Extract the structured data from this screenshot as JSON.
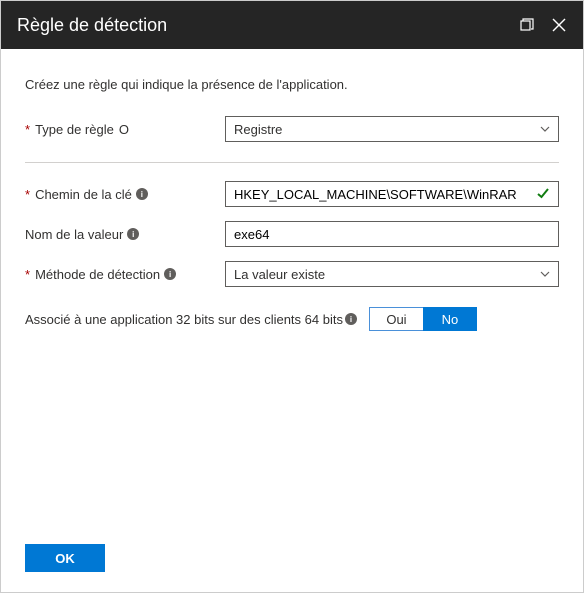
{
  "header": {
    "title": "Règle de détection"
  },
  "description": "Créez une règle qui indique la présence de l'application.",
  "fields": {
    "ruleType": {
      "label": "Type de règle",
      "value": "Registre"
    },
    "keyPath": {
      "label": "Chemin de la clé",
      "value": "HKEY_LOCAL_MACHINE\\SOFTWARE\\WinRAR"
    },
    "valueName": {
      "label": "Nom de la valeur",
      "value": "exe64"
    },
    "detectionMethod": {
      "label": "Méthode de détection",
      "value": "La valeur existe"
    },
    "associated32": {
      "label": "Associé à une application 32 bits sur des clients 64 bits",
      "optionYes": "Oui",
      "optionNo": "No",
      "selected": "No"
    }
  },
  "footer": {
    "ok": "OK"
  },
  "icons": {
    "info": "i",
    "circle": "O"
  }
}
